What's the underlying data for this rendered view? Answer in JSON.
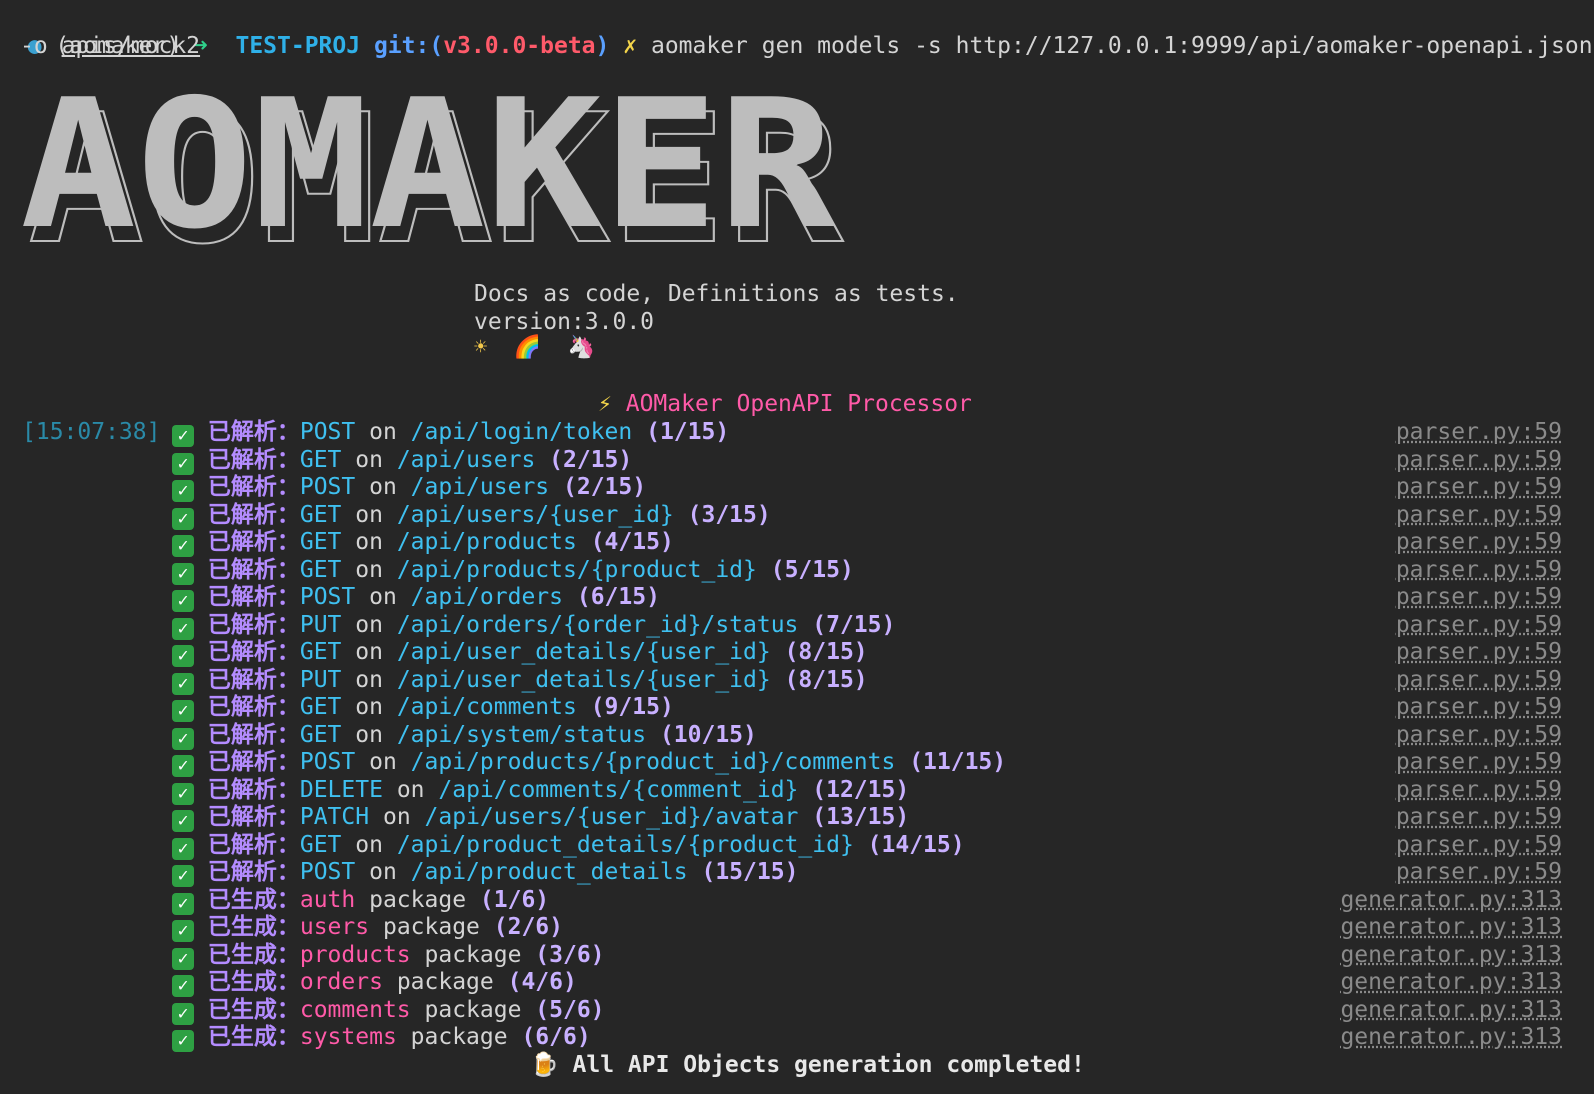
{
  "prompt": {
    "env": "(aomaker)",
    "arrow": "➜",
    "project": "TEST-PROJ",
    "git_label": "git:(",
    "branch": "v3.0.0-beta",
    "git_close": ")",
    "dirty_mark": "✗",
    "command": "aomaker gen models -s http://127.0.0.1:9999/api/aomaker-openapi.json",
    "command_cont_flag": "-o",
    "command_cont_path": "apis/mock2"
  },
  "banner": {
    "text": "AOMAKER",
    "tagline": "Docs as code, Definitions as tests.",
    "version": "version:3.0.0",
    "emojis": [
      "☀",
      "🌈",
      "🦄"
    ]
  },
  "processor_title": "AOMaker OpenAPI Processor",
  "bolt": "⚡",
  "timestamp": "[15:07:38]",
  "parsed_label": "已解析：",
  "generated_label": "已生成：",
  "parsed": [
    {
      "method": "POST",
      "path": "/api/login/token",
      "count": "(1/15)",
      "source": "parser.py:59"
    },
    {
      "method": "GET",
      "path": "/api/users",
      "count": "(2/15)",
      "source": "parser.py:59"
    },
    {
      "method": "POST",
      "path": "/api/users",
      "count": "(2/15)",
      "source": "parser.py:59"
    },
    {
      "method": "GET",
      "path": "/api/users/{user_id}",
      "count": "(3/15)",
      "source": "parser.py:59"
    },
    {
      "method": "GET",
      "path": "/api/products",
      "count": "(4/15)",
      "source": "parser.py:59"
    },
    {
      "method": "GET",
      "path": "/api/products/{product_id}",
      "count": "(5/15)",
      "source": "parser.py:59"
    },
    {
      "method": "POST",
      "path": "/api/orders",
      "count": "(6/15)",
      "source": "parser.py:59"
    },
    {
      "method": "PUT",
      "path": "/api/orders/{order_id}/status",
      "count": "(7/15)",
      "source": "parser.py:59"
    },
    {
      "method": "GET",
      "path": "/api/user_details/{user_id}",
      "count": "(8/15)",
      "source": "parser.py:59"
    },
    {
      "method": "PUT",
      "path": "/api/user_details/{user_id}",
      "count": "(8/15)",
      "source": "parser.py:59"
    },
    {
      "method": "GET",
      "path": "/api/comments",
      "count": "(9/15)",
      "source": "parser.py:59"
    },
    {
      "method": "GET",
      "path": "/api/system/status",
      "count": "(10/15)",
      "source": "parser.py:59"
    },
    {
      "method": "POST",
      "path": "/api/products/{product_id}/comments",
      "count": "(11/15)",
      "source": "parser.py:59"
    },
    {
      "method": "DELETE",
      "path": "/api/comments/{comment_id}",
      "count": "(12/15)",
      "source": "parser.py:59"
    },
    {
      "method": "PATCH",
      "path": "/api/users/{user_id}/avatar",
      "count": "(13/15)",
      "source": "parser.py:59"
    },
    {
      "method": "GET",
      "path": "/api/product_details/{product_id}",
      "count": "(14/15)",
      "source": "parser.py:59"
    },
    {
      "method": "POST",
      "path": "/api/product_details",
      "count": "(15/15)",
      "source": "parser.py:59"
    }
  ],
  "on_word": "on",
  "package_word": "package",
  "generated": [
    {
      "name": "auth",
      "count": "(1/6)",
      "source": "generator.py:313"
    },
    {
      "name": "users",
      "count": "(2/6)",
      "source": "generator.py:313"
    },
    {
      "name": "products",
      "count": "(3/6)",
      "source": "generator.py:313"
    },
    {
      "name": "orders",
      "count": "(4/6)",
      "source": "generator.py:313"
    },
    {
      "name": "comments",
      "count": "(5/6)",
      "source": "generator.py:313"
    },
    {
      "name": "systems",
      "count": "(6/6)",
      "source": "generator.py:313"
    }
  ],
  "completion": {
    "emoji": "🍺",
    "text": "All API Objects generation completed!"
  },
  "colors": {
    "background": "#262626",
    "method": "#3fc0f0",
    "tag": "#b48cff",
    "package": "#ff5aa8",
    "success": "#2ea043"
  }
}
